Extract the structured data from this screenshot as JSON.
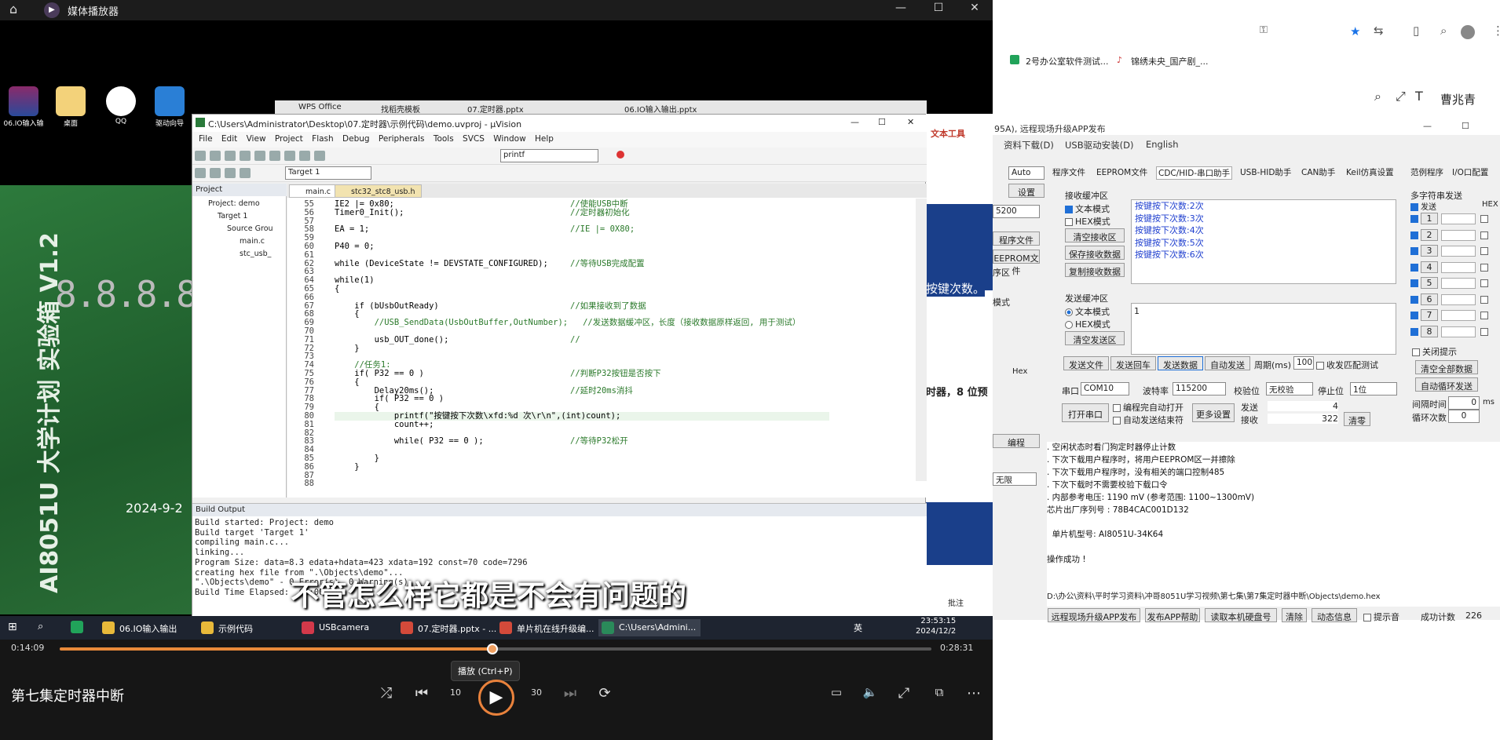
{
  "player": {
    "window_title": "媒体播放器",
    "video_title": "第七集定时器中断",
    "time_current": "0:14:09",
    "time_total": "0:28:31",
    "progress": 0.496,
    "tooltip": "播放 (Ctrl+P)",
    "subtitle": "不管怎么样它都是不会有问题的",
    "skip_back": "10",
    "skip_fwd": "30"
  },
  "desktop_icons": [
    "06.IO输入输",
    "桌面",
    "QQ",
    "驱动向导"
  ],
  "board": {
    "segments": "8.8.8.8.8.8.",
    "text": "AI8051U 大学计划 实验箱 V1.2",
    "year": "2024-9-2"
  },
  "uvision": {
    "title": "C:\\Users\\Administrator\\Desktop\\07.定时器\\示例代码\\demo.uvproj - µVision",
    "menu": [
      "File",
      "Edit",
      "View",
      "Project",
      "Flash",
      "Debug",
      "Peripherals",
      "Tools",
      "SVCS",
      "Window",
      "Help"
    ],
    "find_text": "printf",
    "target": "Target 1",
    "project_header": "Project",
    "tree": [
      "Project: demo",
      "Target 1",
      "Source Grou",
      "main.c",
      "stc_usb_"
    ],
    "tabs": [
      "main.c",
      "stc32_stc8_usb.h"
    ],
    "code": [
      {
        "n": "55",
        "c": "IE2 |= 0x80;",
        "m": "//使能USB中断"
      },
      {
        "n": "56",
        "c": "Timer0_Init();",
        "m": "//定时器初始化"
      },
      {
        "n": "57",
        "c": "",
        "m": ""
      },
      {
        "n": "58",
        "c": "EA = 1;",
        "m": "//IE |= 0X80;"
      },
      {
        "n": "59",
        "c": "",
        "m": ""
      },
      {
        "n": "60",
        "c": "P40 = 0;",
        "m": ""
      },
      {
        "n": "61",
        "c": "",
        "m": ""
      },
      {
        "n": "62",
        "c": "while (DeviceState != DEVSTATE_CONFIGURED);",
        "m": "//等待USB完成配置"
      },
      {
        "n": "63",
        "c": "",
        "m": ""
      },
      {
        "n": "64",
        "c": "while(1)",
        "m": ""
      },
      {
        "n": "65",
        "c": "{",
        "m": ""
      },
      {
        "n": "66",
        "c": "",
        "m": ""
      },
      {
        "n": "67",
        "c": "    if (bUsbOutReady)",
        "m": "//如果接收到了数据"
      },
      {
        "n": "68",
        "c": "    {",
        "m": ""
      },
      {
        "n": "69",
        "c": "        //USB_SendData(UsbOutBuffer,OutNumber);   //发送数据缓冲区，长度（接收数据原样返回, 用于测试）",
        "m": ""
      },
      {
        "n": "70",
        "c": "",
        "m": ""
      },
      {
        "n": "71",
        "c": "        usb_OUT_done();",
        "m": "//"
      },
      {
        "n": "72",
        "c": "    }",
        "m": ""
      },
      {
        "n": "73",
        "c": "",
        "m": ""
      },
      {
        "n": "74",
        "c": "    //任务1:",
        "m": ""
      },
      {
        "n": "75",
        "c": "    if( P32 == 0 )",
        "m": "//判断P32按钮是否按下"
      },
      {
        "n": "76",
        "c": "    {",
        "m": ""
      },
      {
        "n": "77",
        "c": "        Delay20ms();",
        "m": "//延时20ms消抖"
      },
      {
        "n": "78",
        "c": "        if( P32 == 0 )",
        "m": ""
      },
      {
        "n": "79",
        "c": "        {",
        "m": ""
      },
      {
        "n": "80",
        "c": "            printf(\"按键按下次数\\xfd:%d 次\\r\\n\",(int)count);",
        "m": ""
      },
      {
        "n": "81",
        "c": "            count++;",
        "m": ""
      },
      {
        "n": "82",
        "c": "",
        "m": ""
      },
      {
        "n": "83",
        "c": "            while( P32 == 0 );",
        "m": "//等待P32松开"
      },
      {
        "n": "84",
        "c": "",
        "m": ""
      },
      {
        "n": "85",
        "c": "        }",
        "m": ""
      },
      {
        "n": "86",
        "c": "    }",
        "m": ""
      },
      {
        "n": "87",
        "c": "",
        "m": ""
      },
      {
        "n": "88",
        "c": "",
        "m": ""
      }
    ],
    "build_header": "Build Output",
    "build_lines": [
      "Build started: Project: demo",
      "Build target 'Target 1'",
      "compiling main.c...",
      "linking...",
      "Program Size: data=8.3 edata+hdata=423 xdata=192 const=70 code=7296",
      "creating hex file from \".\\Objects\\demo\"...",
      "\".\\Objects\\demo\" - 0 Error(s), 0 Warning(s).",
      "Build Time Elapsed:  00:00:01"
    ]
  },
  "wps": {
    "tabs": [
      "WPS Office",
      "找稻壳模板",
      "07.定时器.pptx",
      "06.IO输入输出.pptx"
    ],
    "ribbon": "文本工具",
    "slide_text_1": "按键次数。",
    "slide_text_2": "时器，8 位预",
    "notes": "批注",
    "hex": "Hex",
    "prog": "程序文件",
    "eeprom": "EEPROM文件",
    "area": "序区",
    "mode": "模式",
    "burn": "编程",
    "speed": "无限"
  },
  "taskbar": {
    "items": [
      "06.IO输入输出",
      "示例代码",
      "USBcamera",
      "07.定时器.pptx - ...",
      "单片机在线升级编...",
      "C:\\Users\\Admini..."
    ],
    "time": "23:53:15",
    "date": "2024/12/2",
    "ime": "英"
  },
  "chrome": {
    "bookmarks": [
      "2号办公室软件测试...",
      "锦绣未央_国产剧_..."
    ],
    "user": "曹兆青"
  },
  "isp": {
    "title": "95A), 远程现场升级APP发布",
    "menu": [
      "资料下载(D)",
      "USB驱动安装(D)",
      "English"
    ],
    "auto": "Auto",
    "settings": "设置",
    "baud_left": "5200",
    "tabs": [
      "程序文件",
      "EEPROM文件",
      "CDC/HID-串口助手",
      "USB-HID助手",
      "CAN助手",
      "Keil仿真设置",
      "范例程序",
      "I/O口配置"
    ],
    "recv_group": "接收缓冲区",
    "text_mode": "文本模式",
    "hex_mode": "HEX模式",
    "clear_recv": "清空接收区",
    "save_recv": "保存接收数据",
    "copy_recv": "复制接收数据",
    "recv_lines": [
      "按键按下次数:2次",
      "按键按下次数:3次",
      "按键按下次数:4次",
      "按键按下次数:5次",
      "按键按下次数:6次"
    ],
    "send_group": "发送缓冲区",
    "clear_send": "清空发送区",
    "send_value": "1",
    "send_file": "发送文件",
    "send_cr": "发送回车",
    "send_data": "发送数据",
    "auto_send": "自动发送",
    "period_label": "周期(ms)",
    "period": "100",
    "match_label": "收发匹配测试",
    "port_label": "串口",
    "port": "COM10",
    "baud_label": "波特率",
    "baud": "115200",
    "parity_label": "校验位",
    "parity": "无校验",
    "stop_label": "停止位",
    "stop": "1位",
    "open_port": "打开串口",
    "auto_open": "编程完自动打开",
    "auto_close": "自动发送结束符",
    "more": "更多设置",
    "sent_label": "发送",
    "sent": "4",
    "recv_label": "接收",
    "recv_count": "322",
    "clear": "清零",
    "multi_title": "多字符串发送",
    "send_col": "发送",
    "hex_col": "HEX",
    "multi_rows": [
      "1",
      "2",
      "3",
      "4",
      "5",
      "6",
      "7",
      "8"
    ],
    "close_hint": "关闭提示",
    "clear_all": "清空全部数据",
    "auto_loop": "自动循环发送",
    "interval_label": "间隔时间",
    "interval": "0",
    "interval_unit": "ms",
    "loop_label": "循环次数",
    "loop": "0",
    "info": [
      ". 空闲状态时看门狗定时器停止计数",
      ". 下次下载用户程序时，将用户EEPROM区一并擦除",
      ". 下次下载用户程序时，没有相关的端口控制485",
      ". 下次下载时不需要校验下载口令",
      ". 内部参考电压: 1190 mV (参考范围: 1100~1300mV)",
      "芯片出厂序列号 : 78B4CAC001D132",
      "",
      "  单片机型号: AI8051U-34K64",
      "",
      "操作成功 !"
    ],
    "path": "D:\\办公\\资料\\平时学习资料\\冲哥8051U学习视频\\第七集\\第7集定时器中断\\Objects\\demo.hex",
    "bottom": [
      "远程现场升级APP发布",
      "发布APP帮助",
      "读取本机硬盘号",
      "清除",
      "动态信息"
    ],
    "beep": "提示音",
    "success_label": "成功计数",
    "success": "226"
  }
}
